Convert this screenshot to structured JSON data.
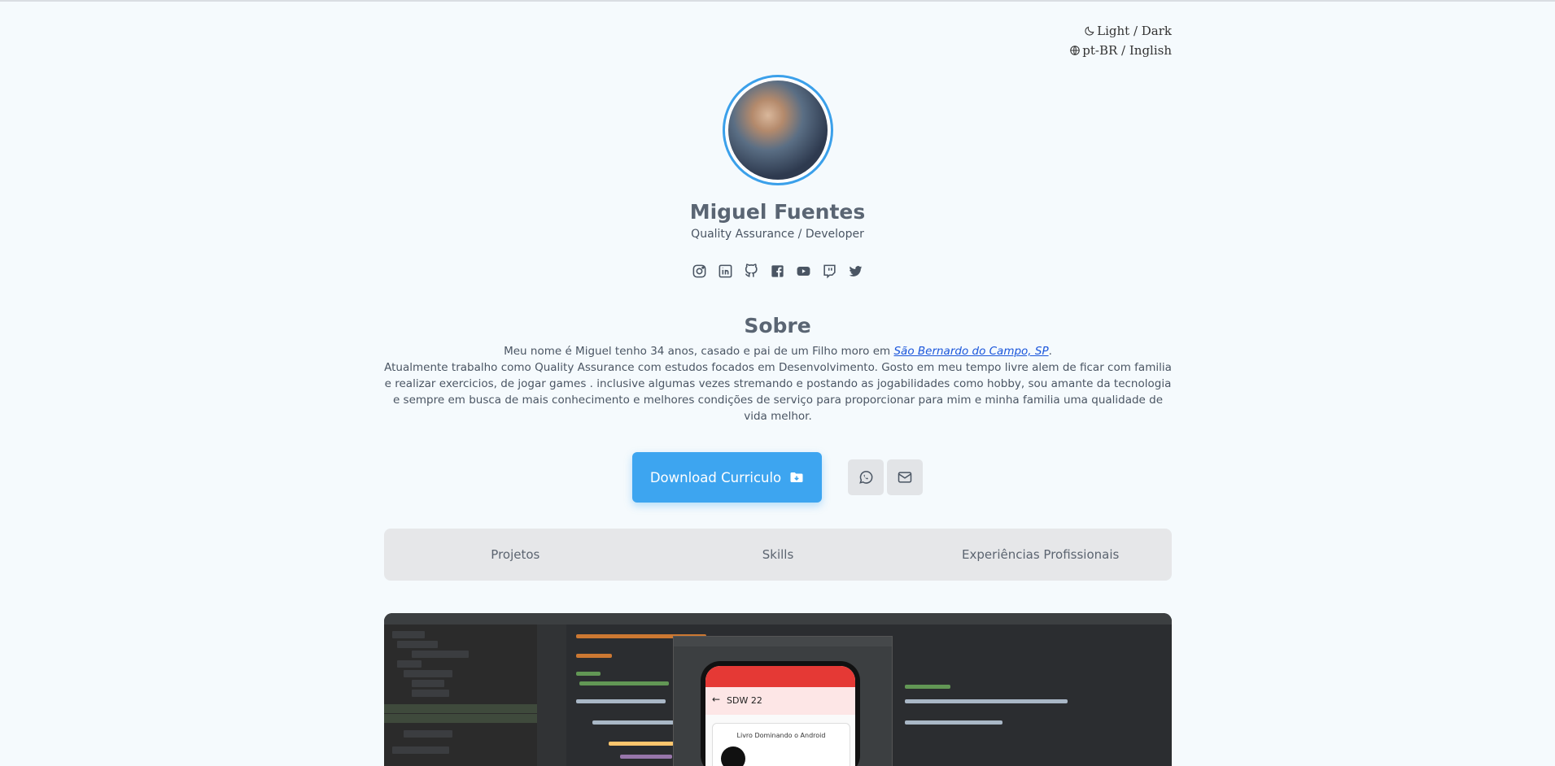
{
  "header": {
    "theme_toggle": "Light / Dark",
    "language_toggle": "pt-BR / Inglish"
  },
  "profile": {
    "name": "Miguel Fuentes",
    "role": "Quality Assurance / Developer",
    "socials": [
      "instagram-icon",
      "linkedin-icon",
      "github-icon",
      "facebook-icon",
      "youtube-icon",
      "twitch-icon",
      "twitter-icon"
    ]
  },
  "about": {
    "title": "Sobre",
    "line1_before": "Meu nome é Miguel tenho 34 anos, casado e pai de um Filho moro em ",
    "location_link": "São Bernardo do Campo, SP",
    "line1_after": ".",
    "paragraph": "Atualmente trabalho como Quality Assurance com estudos focados em Desenvolvimento. Gosto em meu tempo livre alem de ficar com familia e realizar exercicios, de jogar games . inclusive algumas vezes stremando e postando as jogabilidades como hobby, sou amante da tecnologia e sempre em busca de mais conhecimento e melhores condições de serviço para proporcionar para mim e minha familia uma qualidade de vida melhor."
  },
  "actions": {
    "download_label": "Download Curriculo",
    "whatsapp_icon": "whatsapp-icon",
    "email_icon": "mail-icon"
  },
  "tabs": [
    "Projetos",
    "Skills",
    "Experiências Profissionais"
  ],
  "project_preview": {
    "app_title": "SDW 22",
    "card_text": "Livro Dominando o Android"
  },
  "colors": {
    "accent": "#3da5f0",
    "background": "#f5fafd",
    "link": "#1a56db"
  }
}
